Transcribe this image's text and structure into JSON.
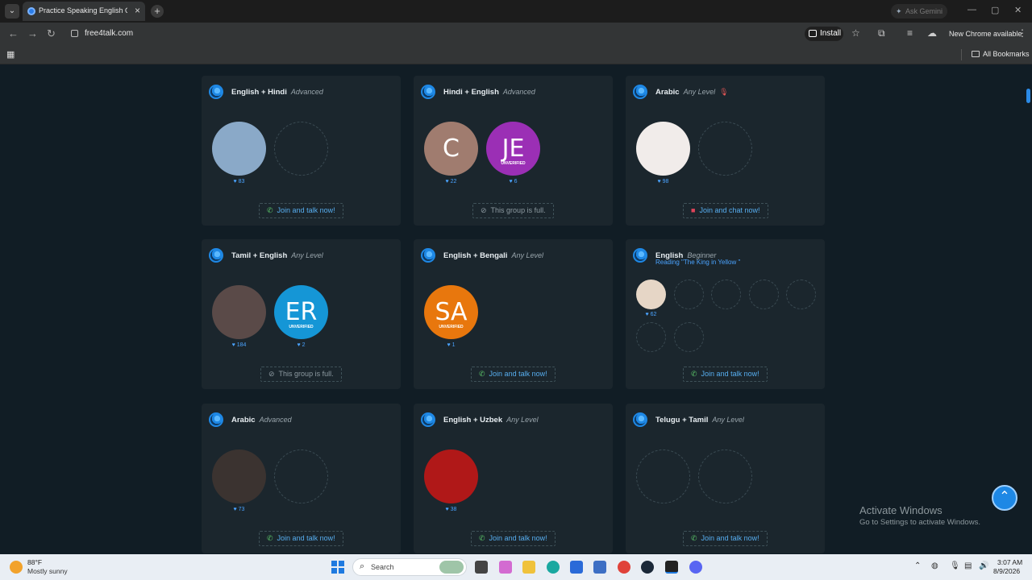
{
  "browser": {
    "tab_title": "Practice Speaking English Onlin",
    "tab_close": "×",
    "new_tab": "+",
    "ask_gemini": "Ask Gemini",
    "url": "free4talk.com",
    "install_label": "Install",
    "new_chrome": "New Chrome available",
    "all_bookmarks": "All Bookmarks",
    "win_min": "—",
    "win_max": "▢",
    "win_close": "✕"
  },
  "cards": [
    {
      "language": "English + Hindi",
      "level": "Advanced",
      "mic_off": false,
      "topic": "",
      "members": [
        {
          "type": "photo",
          "color": "#8aa9c8",
          "likes": "83"
        },
        {
          "type": "empty"
        }
      ],
      "cta": {
        "kind": "join",
        "label": "Join and talk now!",
        "icon": "phone-icon"
      }
    },
    {
      "language": "Hindi + English",
      "level": "Advanced",
      "mic_off": false,
      "topic": "",
      "members": [
        {
          "type": "initials",
          "initials": "C",
          "color": "#a07c6f",
          "unverified": "",
          "likes": "22"
        },
        {
          "type": "initials",
          "initials": "JE",
          "color": "#9b2fb5",
          "unverified": "UNVERIFIED",
          "likes": "6"
        }
      ],
      "cta": {
        "kind": "full",
        "label": "This group is full.",
        "icon": "blocked-icon"
      }
    },
    {
      "language": "Arabic",
      "level": "Any Level",
      "mic_off": true,
      "topic": "",
      "members": [
        {
          "type": "photo",
          "color": "#f1ecea",
          "likes": "98"
        },
        {
          "type": "empty"
        }
      ],
      "cta": {
        "kind": "join",
        "label": "Join and chat now!",
        "icon": "chat-icon"
      }
    },
    {
      "language": "Tamil + English",
      "level": "Any Level",
      "mic_off": false,
      "topic": "",
      "members": [
        {
          "type": "photo",
          "color": "#5a4a48",
          "likes": "184"
        },
        {
          "type": "initials",
          "initials": "ER",
          "color": "#1596d6",
          "unverified": "UNVERIFIED",
          "likes": "2"
        }
      ],
      "cta": {
        "kind": "full",
        "label": "This group is full.",
        "icon": "blocked-icon"
      }
    },
    {
      "language": "English + Bengali",
      "level": "Any Level",
      "mic_off": false,
      "topic": "",
      "members": [
        {
          "type": "initials",
          "initials": "SA",
          "color": "#e8770d",
          "unverified": "UNVERIFIED",
          "likes": "1"
        }
      ],
      "cta": {
        "kind": "join",
        "label": "Join and talk now!",
        "icon": "phone-icon"
      }
    },
    {
      "language": "English",
      "level": "Beginner",
      "mic_off": false,
      "topic": "Reading \"The King in Yellow \"",
      "members": [
        {
          "type": "photo",
          "color": "#e6d6c6",
          "likes": "62"
        },
        {
          "type": "empty"
        },
        {
          "type": "empty"
        },
        {
          "type": "empty"
        },
        {
          "type": "empty"
        },
        {
          "type": "empty"
        },
        {
          "type": "empty"
        }
      ],
      "cta": {
        "kind": "join",
        "label": "Join and talk now!",
        "icon": "phone-icon"
      }
    },
    {
      "language": "Arabic",
      "level": "Advanced",
      "mic_off": false,
      "topic": "",
      "members": [
        {
          "type": "photo",
          "color": "#3b3330",
          "likes": "73"
        },
        {
          "type": "empty"
        }
      ],
      "cta": {
        "kind": "join",
        "label": "Join and talk now!",
        "icon": "phone-icon"
      }
    },
    {
      "language": "English + Uzbek",
      "level": "Any Level",
      "mic_off": false,
      "topic": "",
      "members": [
        {
          "type": "photo",
          "color": "#b01818",
          "likes": "38"
        }
      ],
      "cta": {
        "kind": "join",
        "label": "Join and talk now!",
        "icon": "phone-icon"
      }
    },
    {
      "language": "Telugu + Tamil",
      "level": "Any Level",
      "mic_off": false,
      "topic": "",
      "members": [
        {
          "type": "empty"
        },
        {
          "type": "empty"
        }
      ],
      "cta": {
        "kind": "join",
        "label": "Join and talk now!",
        "icon": "phone-icon"
      }
    }
  ],
  "watermark": {
    "title": "Activate Windows",
    "subtitle": "Go to Settings to activate Windows."
  },
  "scroll_top_icon": "arrow-up-icon",
  "taskbar": {
    "temperature": "88°F",
    "condition": "Mostly sunny",
    "search_label": "Search",
    "time": "3:07 AM",
    "date": "8/9/2026"
  }
}
